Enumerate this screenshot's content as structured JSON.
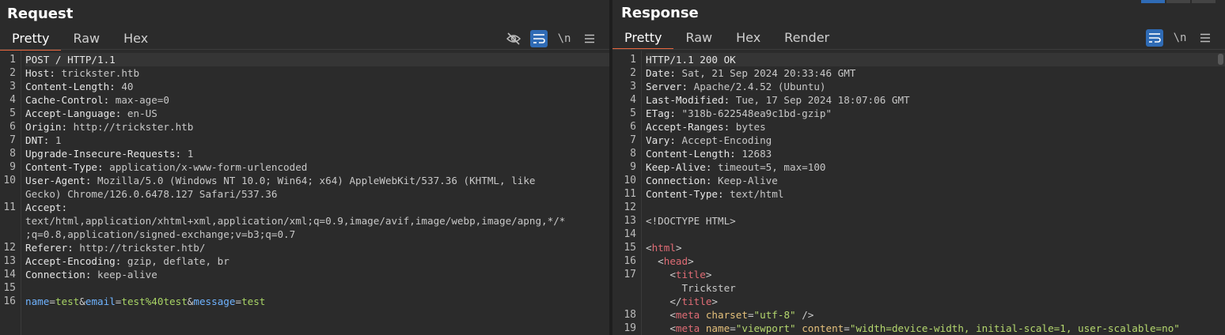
{
  "request": {
    "title": "Request",
    "tabs": [
      "Pretty",
      "Raw",
      "Hex"
    ],
    "active_tab": "Pretty",
    "toolbar": [
      "eye-slash-icon",
      "wrap-icon",
      "\\n",
      "menu-icon"
    ],
    "lines": [
      {
        "n": "1",
        "segs": [
          {
            "t": "POST / HTTP/1.1",
            "c": "hn"
          }
        ]
      },
      {
        "n": "2",
        "segs": [
          {
            "t": "Host: ",
            "c": "hn"
          },
          {
            "t": "trickster.htb",
            "c": "hv"
          }
        ]
      },
      {
        "n": "3",
        "segs": [
          {
            "t": "Content-Length: ",
            "c": "hn"
          },
          {
            "t": "40",
            "c": "hv"
          }
        ]
      },
      {
        "n": "4",
        "segs": [
          {
            "t": "Cache-Control: ",
            "c": "hn"
          },
          {
            "t": "max-age=0",
            "c": "hv"
          }
        ]
      },
      {
        "n": "5",
        "segs": [
          {
            "t": "Accept-Language: ",
            "c": "hn"
          },
          {
            "t": "en-US",
            "c": "hv"
          }
        ]
      },
      {
        "n": "6",
        "segs": [
          {
            "t": "Origin: ",
            "c": "hn"
          },
          {
            "t": "http://trickster.htb",
            "c": "hv"
          }
        ]
      },
      {
        "n": "7",
        "segs": [
          {
            "t": "DNT: ",
            "c": "hn"
          },
          {
            "t": "1",
            "c": "hv"
          }
        ]
      },
      {
        "n": "8",
        "segs": [
          {
            "t": "Upgrade-Insecure-Requests: ",
            "c": "hn"
          },
          {
            "t": "1",
            "c": "hv"
          }
        ]
      },
      {
        "n": "9",
        "segs": [
          {
            "t": "Content-Type: ",
            "c": "hn"
          },
          {
            "t": "application/x-www-form-urlencoded",
            "c": "hv"
          }
        ]
      },
      {
        "n": "10",
        "segs": [
          {
            "t": "User-Agent: ",
            "c": "hn"
          },
          {
            "t": "Mozilla/5.0 (Windows NT 10.0; Win64; x64) AppleWebKit/537.36 (KHTML, like",
            "c": "hv"
          }
        ]
      },
      {
        "n": "",
        "segs": [
          {
            "t": "Gecko) Chrome/126.0.6478.127 Safari/537.36",
            "c": "hv"
          }
        ]
      },
      {
        "n": "11",
        "segs": [
          {
            "t": "Accept: ",
            "c": "hn"
          }
        ]
      },
      {
        "n": "",
        "segs": [
          {
            "t": "text/html,application/xhtml+xml,application/xml;q=0.9,image/avif,image/webp,image/apng,*/*",
            "c": "hv"
          }
        ]
      },
      {
        "n": "",
        "segs": [
          {
            "t": ";q=0.8,application/signed-exchange;v=b3;q=0.7",
            "c": "hv"
          }
        ]
      },
      {
        "n": "12",
        "segs": [
          {
            "t": "Referer: ",
            "c": "hn"
          },
          {
            "t": "http://trickster.htb/",
            "c": "hv"
          }
        ]
      },
      {
        "n": "13",
        "segs": [
          {
            "t": "Accept-Encoding: ",
            "c": "hn"
          },
          {
            "t": "gzip, deflate, br",
            "c": "hv"
          }
        ]
      },
      {
        "n": "14",
        "segs": [
          {
            "t": "Connection: ",
            "c": "hn"
          },
          {
            "t": "keep-alive",
            "c": "hv"
          }
        ]
      },
      {
        "n": "15",
        "segs": []
      },
      {
        "n": "16",
        "segs": [
          {
            "t": "name",
            "c": "pk"
          },
          {
            "t": "=",
            "c": "punct"
          },
          {
            "t": "test",
            "c": "pv"
          },
          {
            "t": "&",
            "c": "punct"
          },
          {
            "t": "email",
            "c": "pk"
          },
          {
            "t": "=",
            "c": "punct"
          },
          {
            "t": "test%40test",
            "c": "pv"
          },
          {
            "t": "&",
            "c": "punct"
          },
          {
            "t": "message",
            "c": "pk"
          },
          {
            "t": "=",
            "c": "punct"
          },
          {
            "t": "test",
            "c": "pv"
          }
        ]
      }
    ]
  },
  "response": {
    "title": "Response",
    "tabs": [
      "Pretty",
      "Raw",
      "Hex",
      "Render"
    ],
    "active_tab": "Pretty",
    "toolbar": [
      "wrap-icon",
      "\\n",
      "menu-icon"
    ],
    "lines": [
      {
        "n": "1",
        "segs": [
          {
            "t": "HTTP/1.1 200 OK",
            "c": "hn"
          }
        ]
      },
      {
        "n": "2",
        "segs": [
          {
            "t": "Date: ",
            "c": "hn"
          },
          {
            "t": "Sat, 21 Sep 2024 20:33:46 GMT",
            "c": "hv"
          }
        ]
      },
      {
        "n": "3",
        "segs": [
          {
            "t": "Server: ",
            "c": "hn"
          },
          {
            "t": "Apache/2.4.52 (Ubuntu)",
            "c": "hv"
          }
        ]
      },
      {
        "n": "4",
        "segs": [
          {
            "t": "Last-Modified: ",
            "c": "hn"
          },
          {
            "t": "Tue, 17 Sep 2024 18:07:06 GMT",
            "c": "hv"
          }
        ]
      },
      {
        "n": "5",
        "segs": [
          {
            "t": "ETag: ",
            "c": "hn"
          },
          {
            "t": "\"318b-622548ea9c1bd-gzip\"",
            "c": "hv"
          }
        ]
      },
      {
        "n": "6",
        "segs": [
          {
            "t": "Accept-Ranges: ",
            "c": "hn"
          },
          {
            "t": "bytes",
            "c": "hv"
          }
        ]
      },
      {
        "n": "7",
        "segs": [
          {
            "t": "Vary: ",
            "c": "hn"
          },
          {
            "t": "Accept-Encoding",
            "c": "hv"
          }
        ]
      },
      {
        "n": "8",
        "segs": [
          {
            "t": "Content-Length: ",
            "c": "hn"
          },
          {
            "t": "12683",
            "c": "hv"
          }
        ]
      },
      {
        "n": "9",
        "segs": [
          {
            "t": "Keep-Alive: ",
            "c": "hn"
          },
          {
            "t": "timeout=5, max=100",
            "c": "hv"
          }
        ]
      },
      {
        "n": "10",
        "segs": [
          {
            "t": "Connection: ",
            "c": "hn"
          },
          {
            "t": "Keep-Alive",
            "c": "hv"
          }
        ]
      },
      {
        "n": "11",
        "segs": [
          {
            "t": "Content-Type: ",
            "c": "hn"
          },
          {
            "t": "text/html",
            "c": "hv"
          }
        ]
      },
      {
        "n": "12",
        "segs": []
      },
      {
        "n": "13",
        "segs": [
          {
            "t": "<!DOCTYPE HTML>",
            "c": "hv"
          }
        ]
      },
      {
        "n": "14",
        "segs": []
      },
      {
        "n": "15",
        "segs": [
          {
            "t": "<",
            "c": "punct"
          },
          {
            "t": "html",
            "c": "tagn"
          },
          {
            "t": ">",
            "c": "punct"
          }
        ]
      },
      {
        "n": "16",
        "segs": [
          {
            "t": "  <",
            "c": "punct"
          },
          {
            "t": "head",
            "c": "tagn"
          },
          {
            "t": ">",
            "c": "punct"
          }
        ]
      },
      {
        "n": "17",
        "segs": [
          {
            "t": "    <",
            "c": "punct"
          },
          {
            "t": "title",
            "c": "tagn"
          },
          {
            "t": ">",
            "c": "punct"
          }
        ]
      },
      {
        "n": "",
        "segs": [
          {
            "t": "      Trickster",
            "c": "hv"
          }
        ]
      },
      {
        "n": "",
        "segs": [
          {
            "t": "    </",
            "c": "punct"
          },
          {
            "t": "title",
            "c": "tagn"
          },
          {
            "t": ">",
            "c": "punct"
          }
        ]
      },
      {
        "n": "18",
        "segs": [
          {
            "t": "    <",
            "c": "punct"
          },
          {
            "t": "meta",
            "c": "tagn"
          },
          {
            "t": " charset",
            "c": "attr"
          },
          {
            "t": "=",
            "c": "punct"
          },
          {
            "t": "\"utf-8\"",
            "c": "str"
          },
          {
            "t": " />",
            "c": "punct"
          }
        ]
      },
      {
        "n": "19",
        "segs": [
          {
            "t": "    <",
            "c": "punct"
          },
          {
            "t": "meta",
            "c": "tagn"
          },
          {
            "t": " name",
            "c": "attr"
          },
          {
            "t": "=",
            "c": "punct"
          },
          {
            "t": "\"viewport\"",
            "c": "str"
          },
          {
            "t": " content",
            "c": "attr"
          },
          {
            "t": "=",
            "c": "punct"
          },
          {
            "t": "\"width=device-width, initial-scale=1, user-scalable=no\"",
            "c": "str"
          }
        ]
      }
    ]
  }
}
